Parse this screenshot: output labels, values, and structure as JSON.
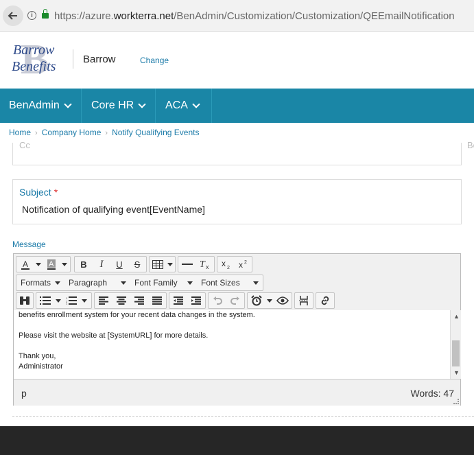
{
  "browser": {
    "url_prefix": "https://azure.",
    "url_host": "workterra.net",
    "url_path": "/BenAdmin/Customization/Customization/QEEmailNotification"
  },
  "header": {
    "logo_line1": "Barrow",
    "logo_line2": "Benefits",
    "logo_letter": "B",
    "company_name": "Barrow",
    "change_label": "Change"
  },
  "nav": {
    "items": [
      {
        "label": "BenAdmin"
      },
      {
        "label": "Core HR"
      },
      {
        "label": "ACA"
      }
    ]
  },
  "breadcrumb": {
    "items": [
      "Home",
      "Company Home",
      "Notify Qualifying Events"
    ],
    "separator": "›"
  },
  "form": {
    "cc_label": "Cc",
    "bcc_label": "Bc",
    "subject_label": "Subject",
    "subject_required": "*",
    "subject_value": "Notification of qualifying event[EventName]",
    "message_label": "Message"
  },
  "editor": {
    "toolbar_selects": [
      "Formats",
      "Paragraph",
      "Font Family",
      "Font Sizes"
    ],
    "content_lines": [
      "benefits enrollment system for your recent data changes in the system.",
      "",
      "Please visit the website at [SystemURL] for more details.",
      "",
      "Thank you,",
      "Administrator"
    ],
    "status_path": "p",
    "word_count": "Words: 47"
  },
  "icons": {
    "back": "back-arrow-icon",
    "info": "info-icon",
    "lock": "lock-icon"
  }
}
